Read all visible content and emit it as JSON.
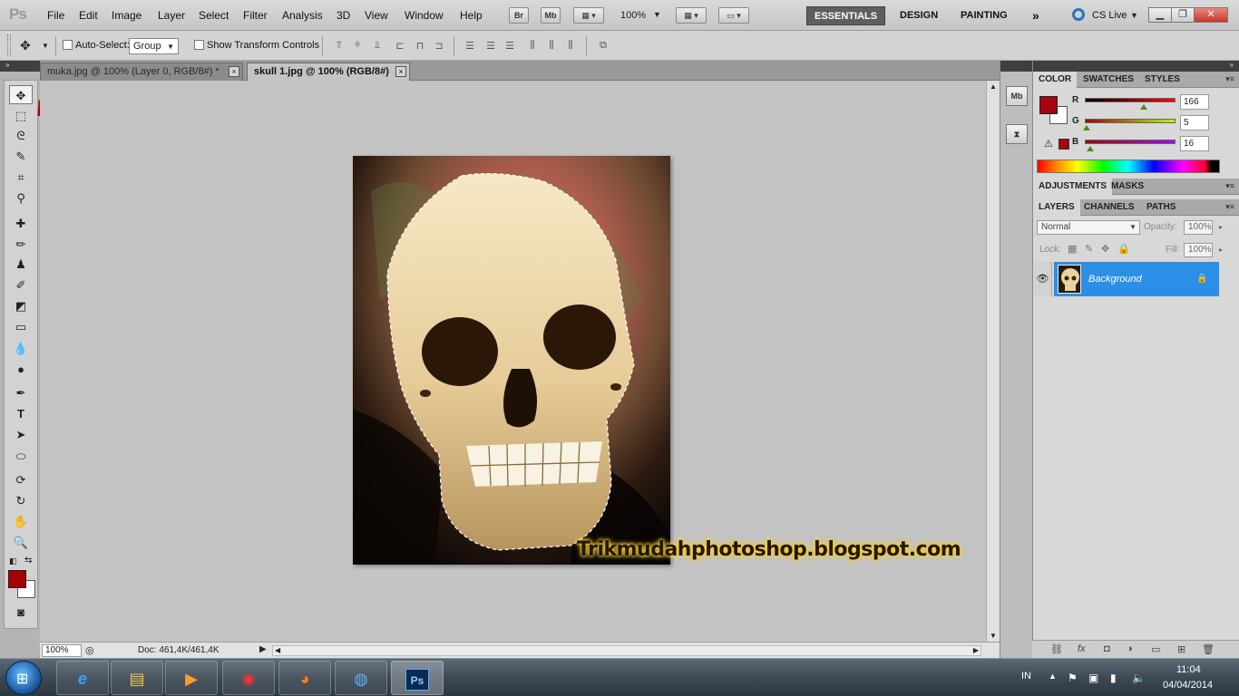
{
  "app": {
    "logo": "Ps",
    "menu": [
      "File",
      "Edit",
      "Image",
      "Layer",
      "Select",
      "Filter",
      "Analysis",
      "3D",
      "View",
      "Window",
      "Help"
    ],
    "bridge_label": "Br",
    "mini_bridge_label": "Mb",
    "zoom_level": "100%",
    "workspaces": [
      "ESSENTIALS",
      "DESIGN",
      "PAINTING"
    ],
    "workspace_more": "»",
    "cslive": "CS Live"
  },
  "options": {
    "auto_select_label": "Auto-Select:",
    "auto_select_value": "Group",
    "show_transform_label": "Show Transform Controls"
  },
  "tabs": [
    {
      "label": "muka.jpg @ 100% (Layer 0, RGB/8#) *",
      "active": false
    },
    {
      "label": "skull 1.jpg @ 100% (RGB/8#)",
      "active": true
    }
  ],
  "tab_close_glyph": "×",
  "status": {
    "zoom": "100%",
    "doc_info": "Doc: 461,4K/461,4K"
  },
  "watermark": "Trikmudahphotoshop.blogspot.com",
  "color_panel": {
    "tabs": [
      "COLOR",
      "SWATCHES",
      "STYLES"
    ],
    "channels": [
      {
        "label": "R",
        "value": "166",
        "fraction": 0.651
      },
      {
        "label": "G",
        "value": "5",
        "fraction": 0.02
      },
      {
        "label": "B",
        "value": "16",
        "fraction": 0.063
      }
    ],
    "foreground": "#a60510",
    "background": "#ffffff"
  },
  "adjust_panel": {
    "tabs": [
      "ADJUSTMENTS",
      "MASKS"
    ]
  },
  "layers_panel": {
    "tabs": [
      "LAYERS",
      "CHANNELS",
      "PATHS"
    ],
    "blend_mode": "Normal",
    "opacity_label": "Opacity:",
    "opacity_value": "100%",
    "lock_label": "Lock:",
    "fill_label": "Fill:",
    "fill_value": "100%",
    "layers": [
      {
        "name": "Background",
        "visible": true,
        "locked": true,
        "selected": true
      }
    ]
  },
  "taskbar": {
    "apps": [
      "ie-icon",
      "explorer-icon",
      "media-player-icon",
      "chrome-icon",
      "firefox-icon",
      "globe-icon",
      "photoshop-icon"
    ],
    "ps_label": "Ps",
    "lang": "IN",
    "time": "11:04",
    "date": "04/04/2014"
  }
}
